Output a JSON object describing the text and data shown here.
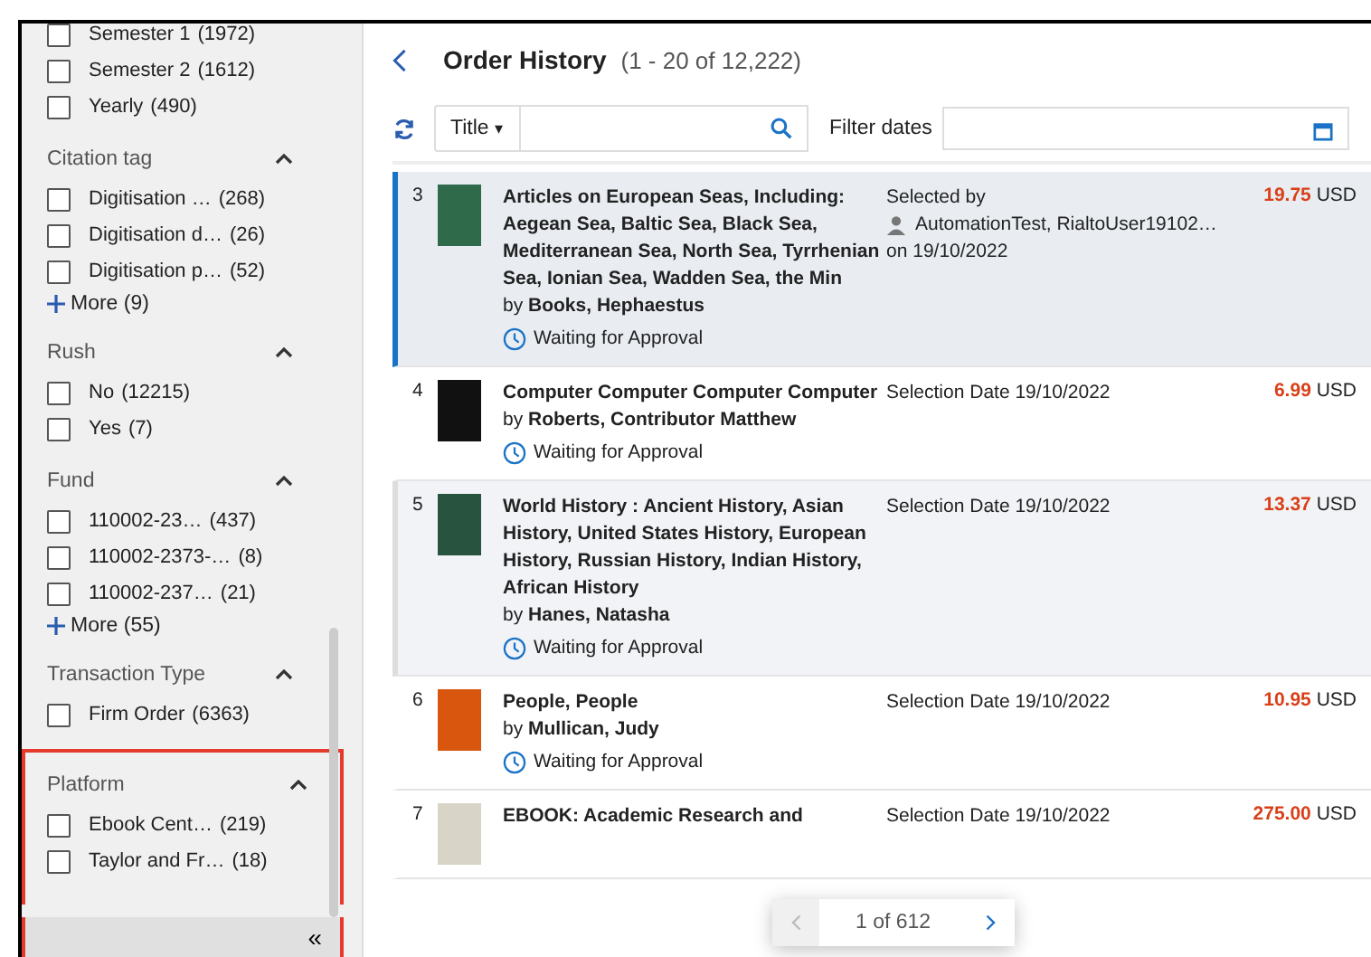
{
  "sidebar": {
    "groups": [
      {
        "options": [
          {
            "label": "Semester 1",
            "count": "(1972)",
            "checked": false
          },
          {
            "label": "Semester 2",
            "count": "(1612)",
            "checked": false
          },
          {
            "label": "Yearly",
            "count": "(490)",
            "checked": false
          }
        ]
      },
      {
        "title": "Citation tag",
        "expanded": true,
        "options": [
          {
            "label": "Digitisation …",
            "count": "(268)",
            "checked": false
          },
          {
            "label": "Digitisation d…",
            "count": "(26)",
            "checked": false
          },
          {
            "label": "Digitisation p…",
            "count": "(52)",
            "checked": false
          }
        ],
        "more": "More (9)"
      },
      {
        "title": "Rush",
        "expanded": true,
        "options": [
          {
            "label": "No",
            "count": "(12215)",
            "checked": false
          },
          {
            "label": "Yes",
            "count": "(7)",
            "checked": false
          }
        ]
      },
      {
        "title": "Fund",
        "expanded": true,
        "options": [
          {
            "label": "110002-23…",
            "count": "(437)",
            "checked": false
          },
          {
            "label": "110002-2373-…",
            "count": "(8)",
            "checked": false
          },
          {
            "label": "110002-237…",
            "count": "(21)",
            "checked": false
          }
        ],
        "more": "More (55)"
      },
      {
        "title": "Transaction Type",
        "expanded": true,
        "options": [
          {
            "label": "Firm Order",
            "count": "(6363)",
            "checked": false
          }
        ]
      },
      {
        "title": "Platform",
        "expanded": true,
        "highlighted": true,
        "options": [
          {
            "label": "Ebook Cent…",
            "count": "(219)",
            "checked": false
          },
          {
            "label": "Taylor and Fr…",
            "count": "(18)",
            "checked": false
          }
        ]
      }
    ],
    "collapse": "«"
  },
  "header": {
    "title": "Order History",
    "range": "(1 - 20 of 12,222)"
  },
  "toolbar": {
    "search_scope": "Title",
    "caret": "▾",
    "filter_label": "Filter dates"
  },
  "orders": [
    {
      "number": "3",
      "title": "Articles on European Seas, Including: Aegean Sea, Baltic Sea, Black Sea, Mediterranean Sea, North Sea, Tyrrhenian Sea, Ionian Sea, Wadden Sea, the Min",
      "by": "by",
      "author": "Books, Hephaestus",
      "status": "Waiting for Approval",
      "kind": "selected_by",
      "date_label": "Selected by",
      "user": "AutomationTest, RialtoUser19102…",
      "date_prefix": "on",
      "date": "19/10/2022",
      "amount": "19.75",
      "currency": "USD",
      "selected": true
    },
    {
      "number": "4",
      "title": "Computer Computer Computer Computer",
      "by": "by",
      "author": "Roberts, Contributor Matthew",
      "status": "Waiting for Approval",
      "kind": "selection_date",
      "date_label": "Selection Date",
      "date": "19/10/2022",
      "amount": "6.99",
      "currency": "USD",
      "selected": false
    },
    {
      "number": "5",
      "title": "World History : Ancient History, Asian History, United States History, European History, Russian History, Indian History, African History",
      "by": "by",
      "author": "Hanes, Natasha",
      "status": "Waiting for Approval",
      "kind": "selection_date",
      "date_label": "Selection Date",
      "date": "19/10/2022",
      "amount": "13.37",
      "currency": "USD",
      "selected": false,
      "hovered": true
    },
    {
      "number": "6",
      "title": "People, People",
      "by": "by",
      "author": "Mullican, Judy",
      "status": "Waiting for Approval",
      "kind": "selection_date",
      "date_label": "Selection Date",
      "date": "19/10/2022",
      "amount": "10.95",
      "currency": "USD",
      "selected": false
    },
    {
      "number": "7",
      "title": "EBOOK: Academic Research and",
      "kind": "selection_date",
      "date_label": "Selection Date",
      "date": "19/10/2022",
      "amount": "275.00",
      "currency": "USD",
      "selected": false
    }
  ],
  "pagination": {
    "text": "1 of 612",
    "prev_disabled": true
  }
}
